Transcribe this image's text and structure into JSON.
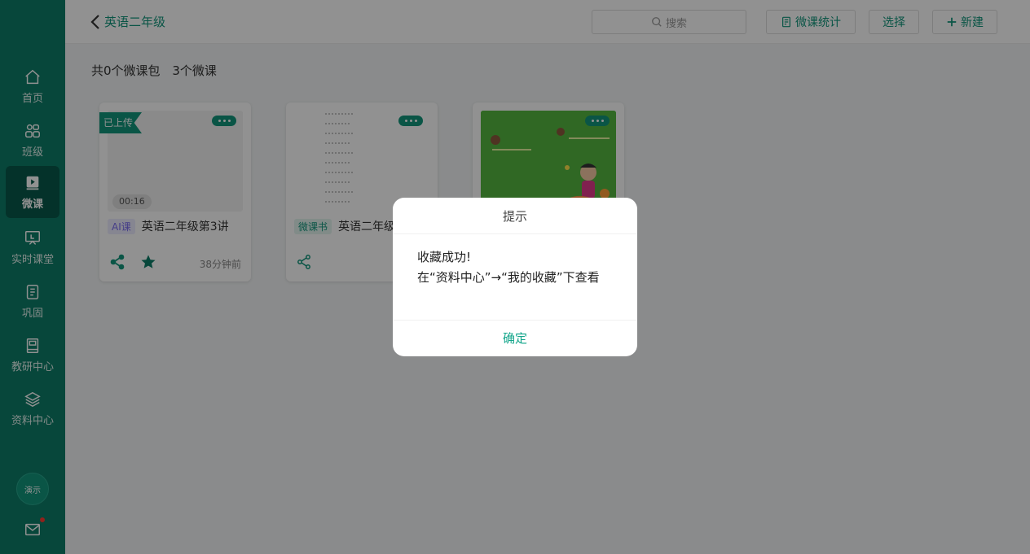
{
  "sidebar": {
    "items": [
      {
        "label": "首页",
        "icon": "home-icon"
      },
      {
        "label": "班级",
        "icon": "group-icon"
      },
      {
        "label": "微课",
        "icon": "video-lesson-icon"
      },
      {
        "label": "实时课堂",
        "icon": "live-class-icon"
      },
      {
        "label": "巩固",
        "icon": "notebook-icon"
      },
      {
        "label": "教研中心",
        "icon": "research-icon"
      },
      {
        "label": "资料中心",
        "icon": "layers-icon"
      }
    ],
    "active": "微课",
    "avatar_label": "演示"
  },
  "header": {
    "back_label": "英语二年级",
    "search_placeholder": "搜索",
    "stats_label": "微课统计",
    "select_label": "选择",
    "new_label": "新建"
  },
  "summary": {
    "packages": "共0个微课包",
    "lessons": "3个微课"
  },
  "cards": [
    {
      "ribbon": "已上传",
      "duration": "00:16",
      "tag": "AI课",
      "title": "英语二年级第3讲",
      "time": "38分钟前"
    },
    {
      "tag": "微课书",
      "title": "英语二年级"
    },
    {}
  ],
  "dialog": {
    "title": "提示",
    "line1": "收藏成功!",
    "line2": "在“资料中心”→“我的收藏”下查看",
    "ok": "确定"
  },
  "colors": {
    "primary": "#0e7e68",
    "accent": "#12967c",
    "active_nav": "#08584a"
  }
}
